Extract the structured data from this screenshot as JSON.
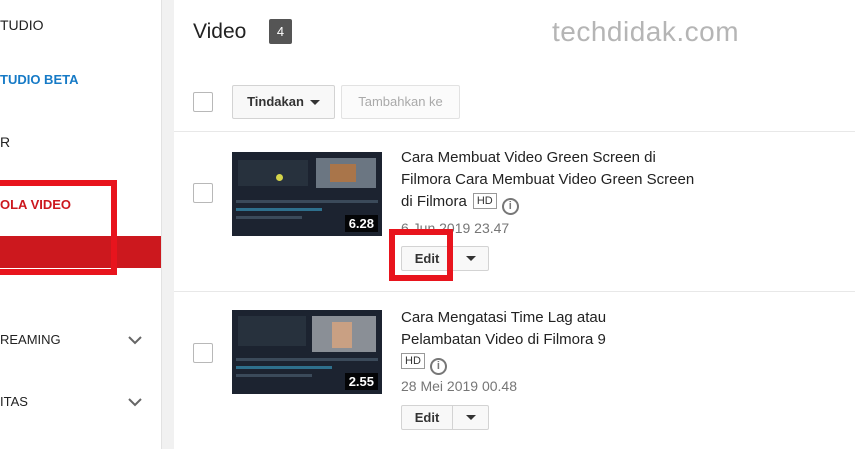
{
  "sidebar": {
    "items": [
      {
        "label": "TUDIO"
      },
      {
        "label": "TUDIO BETA"
      },
      {
        "label": "R"
      },
      {
        "label": "OLA VIDEO"
      },
      {
        "label": "REAMING",
        "chevron": "chevron-down-icon"
      },
      {
        "label": "ITAS",
        "chevron": "chevron-down-icon"
      }
    ]
  },
  "header": {
    "title": "Video",
    "count": "4",
    "watermark": "techdidak.com"
  },
  "toolbar": {
    "actions_label": "Tindakan",
    "add_to_label": "Tambahkan ke"
  },
  "videos": [
    {
      "title": "Cara Membuat Video Green Screen di Filmora Cara Membuat Video Green Screen di Filmora",
      "badge": "HD",
      "date": "6 Jun 2019 23.47",
      "duration": "6.28",
      "edit_label": "Edit"
    },
    {
      "title": "Cara Mengatasi Time Lag atau Pelambatan Video di Filmora 9",
      "badge": "HD",
      "date": "28 Mei 2019 00.48",
      "duration": "2.55",
      "edit_label": "Edit"
    }
  ],
  "colors": {
    "accent_red": "#cc181e",
    "annotation_red": "#e8141d",
    "link_blue": "#167ac6"
  }
}
